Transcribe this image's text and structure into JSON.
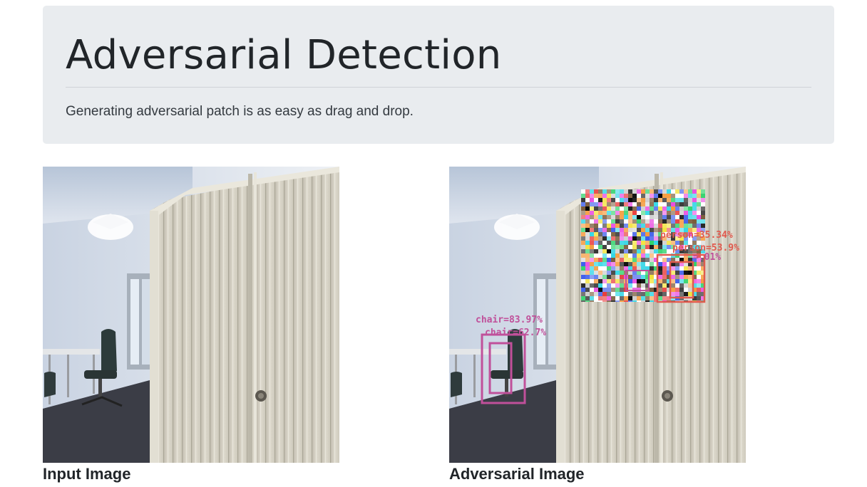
{
  "header": {
    "title": "Adversarial Detection",
    "subtitle": "Generating adversarial patch is as easy as drag and drop."
  },
  "input_panel": {
    "caption": "Input Image"
  },
  "adversarial_panel": {
    "caption": "Adversarial Image",
    "detections": [
      {
        "label": "chair=83.97%",
        "color": "#c0509a"
      },
      {
        "label": "chair=62.7%",
        "color": "#c0509a"
      },
      {
        "label": "person=35.34%",
        "color": "#e05a4e"
      },
      {
        "label": "person=53.9%",
        "color": "#e05a4e"
      },
      {
        "label": "=.01%",
        "color": "#c0509a"
      }
    ]
  },
  "colors": {
    "jumbotron_bg": "#e9ecef",
    "cabinet": "#d9d5c8",
    "chair_box": "#c0509a",
    "person_box": "#e05a4e"
  }
}
